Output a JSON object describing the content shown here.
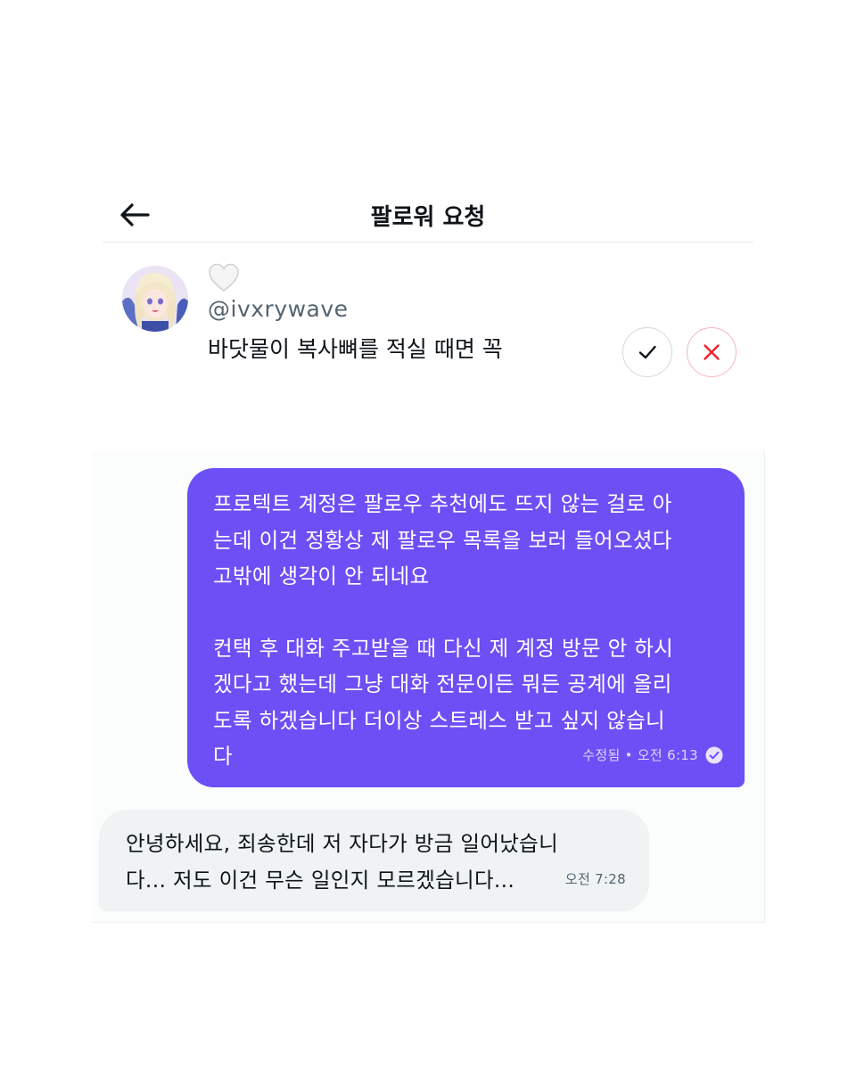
{
  "header": {
    "title": "팔로워 요청"
  },
  "request": {
    "username_heart": "white-heart-emoji",
    "handle": "@ivxrywave",
    "bio": "바닷물이 복사뼈를 적실 때면 꼭"
  },
  "chat": {
    "sent_message": {
      "paragraph_1": "프로텍트 계정은 팔로우 추천에도 뜨지 않는 걸로 아\n는데 이건 정황상 제 팔로우 목록을 보러 들어오셨다\n고밖에 생각이 안 되네요",
      "paragraph_2": "컨택 후 대화 주고받을 때 다신 제 계정 방문 안 하시\n겠다고 했는데 그냥 대화 전문이든 뭐든 공계에 올리\n도록 하겠습니다 더이상 스트레스 받고 싶지 않습니\n다",
      "meta": "수정됨 • 오전 6:13"
    },
    "received_message": {
      "text": "안녕하세요, 죄송한데 저 자다가 방금 일어났습니\n다... 저도 이건 무슨 일인지 모르겠습니다...",
      "time": "오전 7:28"
    }
  },
  "colors": {
    "sent_bubble": "#6d4ff6",
    "received_bubble": "#eff3f4",
    "decline_accent": "#f4212e"
  }
}
